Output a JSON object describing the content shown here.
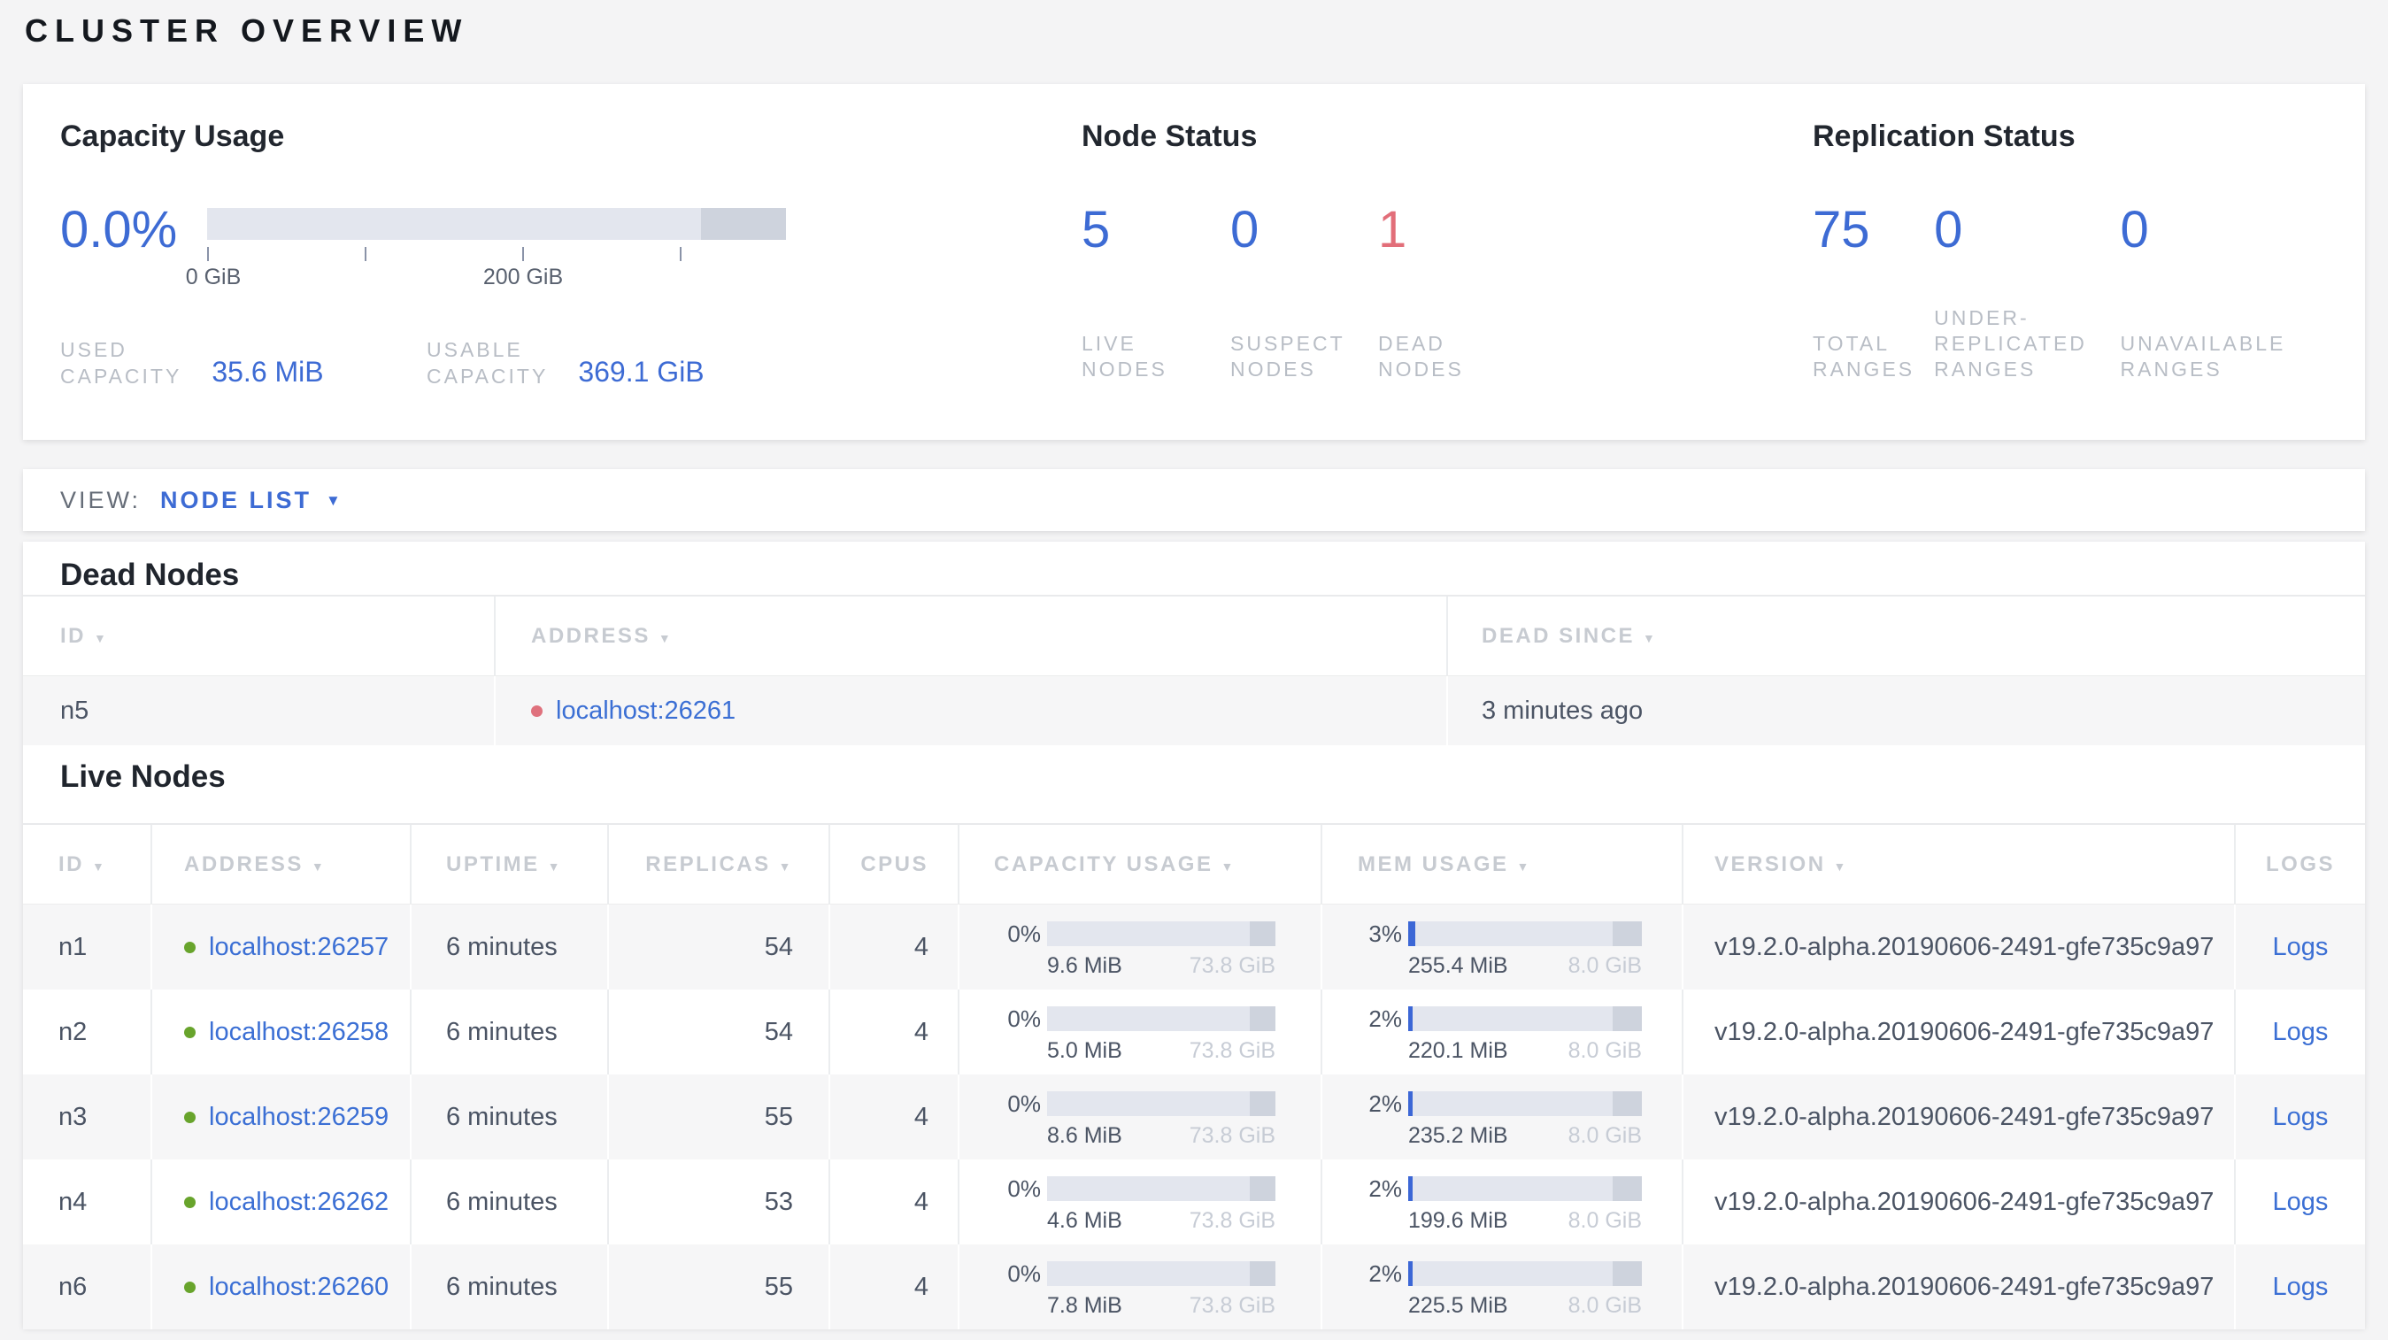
{
  "page": {
    "title": "CLUSTER OVERVIEW"
  },
  "icons": {
    "sort_arrow": "▼",
    "dropdown_arrow": "▼"
  },
  "colors": {
    "accent_blue": "#3d6bd4",
    "danger_red": "#e26e79",
    "healthy_green": "#68a42c",
    "dead_dot_red": "#df717d"
  },
  "summary": {
    "capacity_usage": {
      "title": "Capacity Usage",
      "percent": "0.0%",
      "axis_tick_labels": [
        "0 GiB",
        "200 GiB"
      ],
      "used": {
        "label_lines": [
          "USED",
          "CAPACITY"
        ],
        "value": "35.6 MiB"
      },
      "usable": {
        "label_lines": [
          "USABLE",
          "CAPACITY"
        ],
        "value": "369.1 GiB"
      }
    },
    "node_status": {
      "title": "Node Status",
      "stats": [
        {
          "value": "5",
          "label_lines": [
            "LIVE",
            "NODES"
          ]
        },
        {
          "value": "0",
          "label_lines": [
            "SUSPECT",
            "NODES"
          ]
        },
        {
          "value": "1",
          "label_lines": [
            "DEAD",
            "NODES"
          ]
        }
      ]
    },
    "replication_status": {
      "title": "Replication Status",
      "stats": [
        {
          "value": "75",
          "label_lines": [
            "TOTAL",
            "RANGES"
          ]
        },
        {
          "value": "0",
          "label_lines": [
            "UNDER-",
            "REPLICATED",
            "RANGES"
          ]
        },
        {
          "value": "0",
          "label_lines": [
            "UNAVAILABLE",
            "RANGES"
          ]
        }
      ]
    }
  },
  "view_bar": {
    "label": "VIEW:",
    "selected": "NODE LIST"
  },
  "dead_nodes": {
    "heading": "Dead Nodes",
    "columns": [
      {
        "label": "ID"
      },
      {
        "label": "ADDRESS"
      },
      {
        "label": "DEAD SINCE"
      }
    ],
    "rows": [
      {
        "id": "n5",
        "address": "localhost:26261",
        "dead_since": "3 minutes ago"
      }
    ]
  },
  "live_nodes": {
    "heading": "Live Nodes",
    "columns": [
      {
        "label": "ID"
      },
      {
        "label": "ADDRESS"
      },
      {
        "label": "UPTIME"
      },
      {
        "label": "REPLICAS"
      },
      {
        "label": "CPUS"
      },
      {
        "label": "CAPACITY USAGE"
      },
      {
        "label": "MEM USAGE"
      },
      {
        "label": "VERSION"
      },
      {
        "label": "LOGS"
      }
    ],
    "logs_label": "Logs",
    "rows": [
      {
        "id": "n1",
        "address": "localhost:26257",
        "uptime": "6 minutes",
        "replicas": "54",
        "cpus": "4",
        "capacity": {
          "pct": "0%",
          "pct_num": 0,
          "used": "9.6 MiB",
          "total": "73.8 GiB"
        },
        "memory": {
          "pct": "3%",
          "pct_num": 3,
          "used": "255.4 MiB",
          "total": "8.0 GiB"
        },
        "version": "v19.2.0-alpha.20190606-2491-gfe735c9a97"
      },
      {
        "id": "n2",
        "address": "localhost:26258",
        "uptime": "6 minutes",
        "replicas": "54",
        "cpus": "4",
        "capacity": {
          "pct": "0%",
          "pct_num": 0,
          "used": "5.0 MiB",
          "total": "73.8 GiB"
        },
        "memory": {
          "pct": "2%",
          "pct_num": 2,
          "used": "220.1 MiB",
          "total": "8.0 GiB"
        },
        "version": "v19.2.0-alpha.20190606-2491-gfe735c9a97"
      },
      {
        "id": "n3",
        "address": "localhost:26259",
        "uptime": "6 minutes",
        "replicas": "55",
        "cpus": "4",
        "capacity": {
          "pct": "0%",
          "pct_num": 0,
          "used": "8.6 MiB",
          "total": "73.8 GiB"
        },
        "memory": {
          "pct": "2%",
          "pct_num": 2,
          "used": "235.2 MiB",
          "total": "8.0 GiB"
        },
        "version": "v19.2.0-alpha.20190606-2491-gfe735c9a97"
      },
      {
        "id": "n4",
        "address": "localhost:26262",
        "uptime": "6 minutes",
        "replicas": "53",
        "cpus": "4",
        "capacity": {
          "pct": "0%",
          "pct_num": 0,
          "used": "4.6 MiB",
          "total": "73.8 GiB"
        },
        "memory": {
          "pct": "2%",
          "pct_num": 2,
          "used": "199.6 MiB",
          "total": "8.0 GiB"
        },
        "version": "v19.2.0-alpha.20190606-2491-gfe735c9a97"
      },
      {
        "id": "n6",
        "address": "localhost:26260",
        "uptime": "6 minutes",
        "replicas": "55",
        "cpus": "4",
        "capacity": {
          "pct": "0%",
          "pct_num": 0,
          "used": "7.8 MiB",
          "total": "73.8 GiB"
        },
        "memory": {
          "pct": "2%",
          "pct_num": 2,
          "used": "225.5 MiB",
          "total": "8.0 GiB"
        },
        "version": "v19.2.0-alpha.20190606-2491-gfe735c9a97"
      }
    ]
  }
}
